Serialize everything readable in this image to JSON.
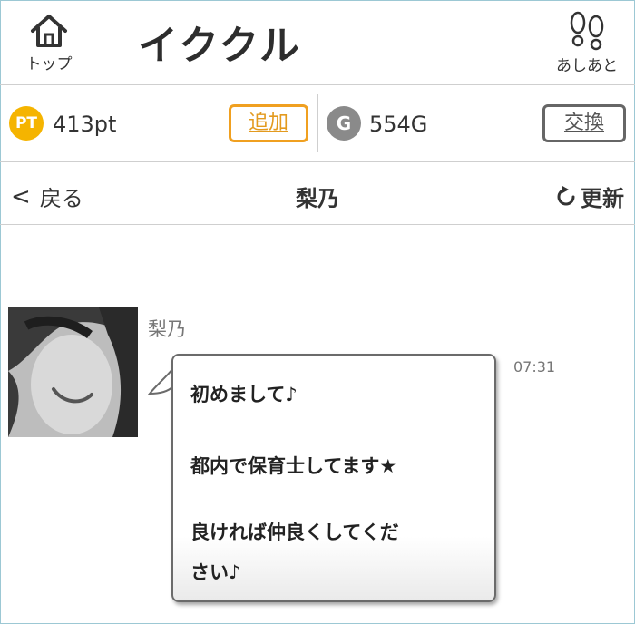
{
  "header": {
    "home_label": "トップ",
    "logo_text": "イククル",
    "footprints_label": "あしあと"
  },
  "points": {
    "pt_badge": "PT",
    "pt_value": "413pt",
    "add_label": "追加",
    "g_badge": "G",
    "g_value": "554G",
    "exchange_label": "交換",
    "pt_color": "#f5b400",
    "add_color": "#f0a020"
  },
  "titlebar": {
    "back_label": "戻る",
    "title": "梨乃",
    "refresh_label": "更新"
  },
  "message": {
    "sender": "梨乃",
    "time": "07:31",
    "lines": [
      "初めまして♪",
      "都内で保育士してます★",
      "良ければ仲良くしてくだ",
      "さい♪"
    ]
  }
}
